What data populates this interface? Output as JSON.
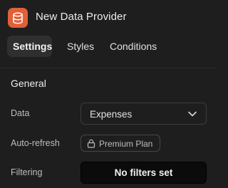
{
  "header": {
    "title": "New Data Provider",
    "icon": "database-icon",
    "icon_color": "#e0603a"
  },
  "tabs": [
    {
      "label": "Settings",
      "active": true
    },
    {
      "label": "Styles",
      "active": false
    },
    {
      "label": "Conditions",
      "active": false
    }
  ],
  "general": {
    "section_title": "General",
    "data": {
      "label": "Data",
      "value": "Expenses"
    },
    "auto_refresh": {
      "label": "Auto-refresh",
      "badge_icon": "lock-icon",
      "badge": "Premium Plan"
    },
    "filtering": {
      "label": "Filtering",
      "button": "No filters set"
    }
  }
}
